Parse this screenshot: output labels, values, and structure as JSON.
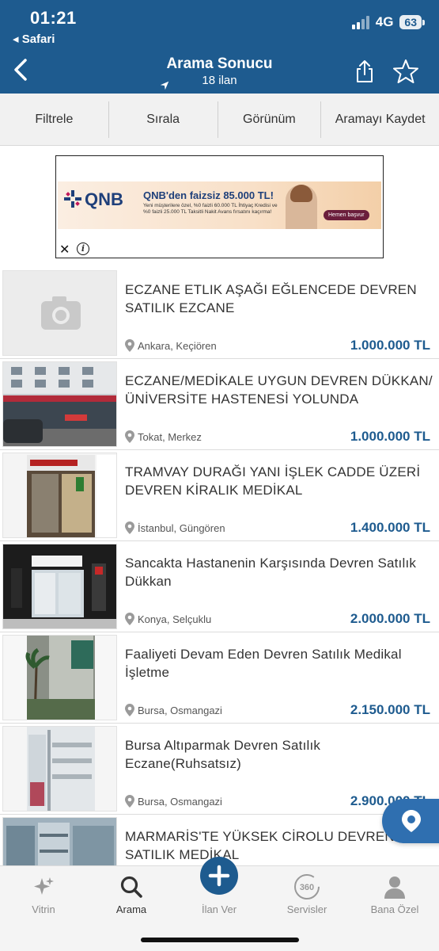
{
  "status_bar": {
    "time": "01:21",
    "back_app": "◂ Safari",
    "network": "4G",
    "battery": "63"
  },
  "nav": {
    "title": "Arama Sonucu",
    "subtitle": "18 ilan"
  },
  "toolbar": {
    "filter": "Filtrele",
    "sort": "Sırala",
    "view": "Görünüm",
    "save_search": "Aramayı Kaydet"
  },
  "ad": {
    "brand": "QNB",
    "headline": "QNB'den faizsiz 85.000 TL!",
    "small_text": "Yeni müşterilere özel, %0 faizli 60.000 TL İhtiyaç Kredisi ve %0 faizli 25.000 TL Taksitli Nakit Avans fırsatını kaçırma!",
    "cta": "Hemen başvur",
    "close": "✕",
    "info": "i"
  },
  "listings": [
    {
      "title": "ECZANE ETLIK AŞAĞI EĞLENCEDE DEVREN SATILIK EZCANE",
      "location": "Ankara, Keçiören",
      "price": "1.000.000 TL",
      "image": "placeholder"
    },
    {
      "title": "ECZANE/MEDİKALE UYGUN DEVREN DÜKKAN/ÜNİVERSİTE HASTENESİ YOLUNDA",
      "location": "Tokat, Merkez",
      "price": "1.000.000 TL",
      "image": "street-building"
    },
    {
      "title": "TRAMVAY DURAĞI YANI İŞLEK CADDE ÜZERİ DEVREN KİRALIK MEDİKAL",
      "location": "İstanbul, Güngören",
      "price": "1.400.000 TL",
      "image": "medical-storefront"
    },
    {
      "title": "Sancakta Hastanenin Karşısında Devren Satılık Dükkan",
      "location": "Konya, Selçuklu",
      "price": "2.000.000 TL",
      "image": "pharmacy-storefront"
    },
    {
      "title": "Faaliyeti Devam Eden Devren Satılık Medikal İşletme",
      "location": "Bursa, Osmangazi",
      "price": "2.150.000 TL",
      "image": "palm-building"
    },
    {
      "title": "Bursa Altıparmak Devren Satılık Eczane(Ruhsatsız)",
      "location": "Bursa, Osmangazi",
      "price": "2.900.000 TL",
      "image": "pharmacy-interior"
    },
    {
      "title": "MARMARİS'TE YÜKSEK CİROLU DEVREN SATILIK MEDİKAL",
      "location": "",
      "price": "",
      "image": "shelves-interior"
    }
  ],
  "tabs": [
    {
      "label": "Vitrin",
      "icon": "sparkle-icon"
    },
    {
      "label": "Arama",
      "icon": "search-icon"
    },
    {
      "label": "İlan Ver",
      "icon": "plus-icon"
    },
    {
      "label": "Servisler",
      "icon": "360-icon"
    },
    {
      "label": "Bana Özel",
      "icon": "user-icon"
    }
  ],
  "colors": {
    "brand": "#1e5b8f",
    "price": "#1e5b8f",
    "fab": "#2f6fb0"
  }
}
